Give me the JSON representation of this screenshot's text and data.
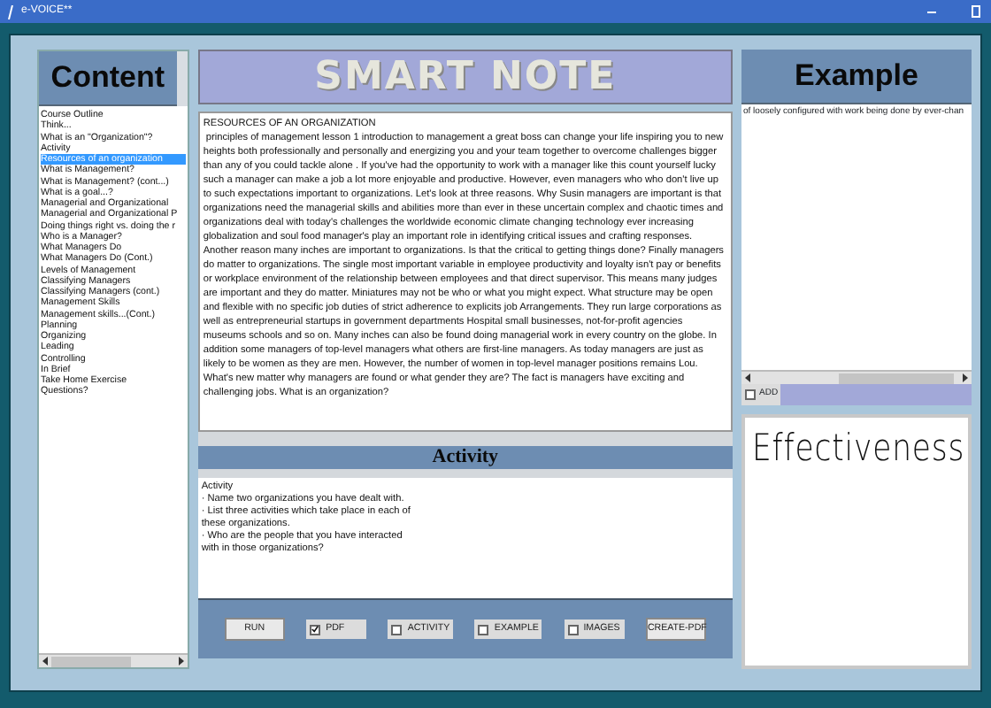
{
  "window": {
    "title": "e-VOICE**"
  },
  "content": {
    "title": "Content",
    "items": [
      {
        "label": "Course Outline",
        "selected": false
      },
      {
        "label": "Think...",
        "selected": false
      },
      {
        "label": "What is an \"Organization\"?",
        "selected": false
      },
      {
        "label": "Activity",
        "selected": false
      },
      {
        "label": "Resources of an organization",
        "selected": true
      },
      {
        "label": "What is Management?",
        "selected": false
      },
      {
        "label": "What is Management? (cont...)",
        "selected": false
      },
      {
        "label": "What is a goal...?",
        "selected": false
      },
      {
        "label": "Managerial and Organizational",
        "selected": false
      },
      {
        "label": "Managerial and Organizational P",
        "selected": false
      },
      {
        "label": "Doing things right vs. doing the r",
        "selected": false
      },
      {
        "label": "Who is a Manager?",
        "selected": false
      },
      {
        "label": "What Managers Do",
        "selected": false
      },
      {
        "label": "What Managers Do (Cont.)",
        "selected": false
      },
      {
        "label": "Levels of Management",
        "selected": false
      },
      {
        "label": "Classifying Managers",
        "selected": false
      },
      {
        "label": "Classifying Managers (cont.)",
        "selected": false
      },
      {
        "label": "Management Skills",
        "selected": false
      },
      {
        "label": "Management skills...(Cont.)",
        "selected": false
      },
      {
        "label": "Planning",
        "selected": false
      },
      {
        "label": "Organizing",
        "selected": false
      },
      {
        "label": "Leading",
        "selected": false
      },
      {
        "label": "Controlling",
        "selected": false
      },
      {
        "label": "In Brief",
        "selected": false
      },
      {
        "label": "Take Home Exercise",
        "selected": false
      },
      {
        "label": "Questions?",
        "selected": false
      }
    ]
  },
  "smart_note": {
    "title": "SMART NOTE",
    "heading": "RESOURCES OF AN ORGANIZATION",
    "text": " principles of management lesson 1 introduction to management a great boss can change your life inspiring you to new heights both professionally and personally and energizing you and your team together to overcome challenges bigger than any of you could tackle alone . If you've had the opportunity to work with a manager like this count yourself lucky such a manager can make a job a lot more enjoyable and productive. However, even managers who who don't live up to such expectations important to organizations. Let's look at three reasons. Why Susin managers are important is that organizations need the managerial skills and abilities more than ever in these uncertain complex and chaotic times and organizations deal with today's challenges the worldwide economic climate changing technology ever increasing globalization and soul food manager's play an important role in identifying critical issues and crafting responses. Another reason many inches are important to organizations. Is that the critical to getting things done? Finally managers do matter to organizations. The single most important variable in employee productivity and loyalty isn't pay or benefits or workplace environment of the relationship between employees and that direct supervisor. This means many judges are important and they do matter. Miniatures may not be who or what you might expect. What structure may be open and flexible with no specific job duties of strict adherence to explicits job Arrangements. They run large corporations as well as entrepreneurial startups in government departments Hospital small businesses, not-for-profit agencies museums schools and so on. Many inches can also be found doing managerial work in every country on the globe. In addition some managers of top-level managers what others are first-line managers. As today managers are just as likely to be women as they are men. However, the number of women in top-level manager positions remains Lou. What's new matter why managers are found or what gender they are? The fact is managers have exciting and challenging jobs. What is an organization?"
  },
  "activity": {
    "title": "Activity",
    "lines": [
      "Activity",
      "· Name two organizations you have dealt with.",
      "· List three activities which take place in each of",
      "these organizations.",
      "· Who are the people that you have interacted",
      "with in those organizations?"
    ]
  },
  "controls": [
    {
      "kind": "button",
      "label": "RUN"
    },
    {
      "kind": "checkbox",
      "label": "PDF",
      "checked": true
    },
    {
      "kind": "checkbox",
      "label": "ACTIVITY",
      "checked": false
    },
    {
      "kind": "checkbox",
      "label": "EXAMPLE",
      "checked": false
    },
    {
      "kind": "checkbox",
      "label": "IMAGES",
      "checked": false
    },
    {
      "kind": "button",
      "label": "CREATE-PDF"
    }
  ],
  "example": {
    "title": "Example",
    "text": "of loosely configured with work being done by ever-chan",
    "add": {
      "label": "ADD",
      "checked": false
    }
  },
  "handwriting": {
    "text": "Effectiveness"
  }
}
